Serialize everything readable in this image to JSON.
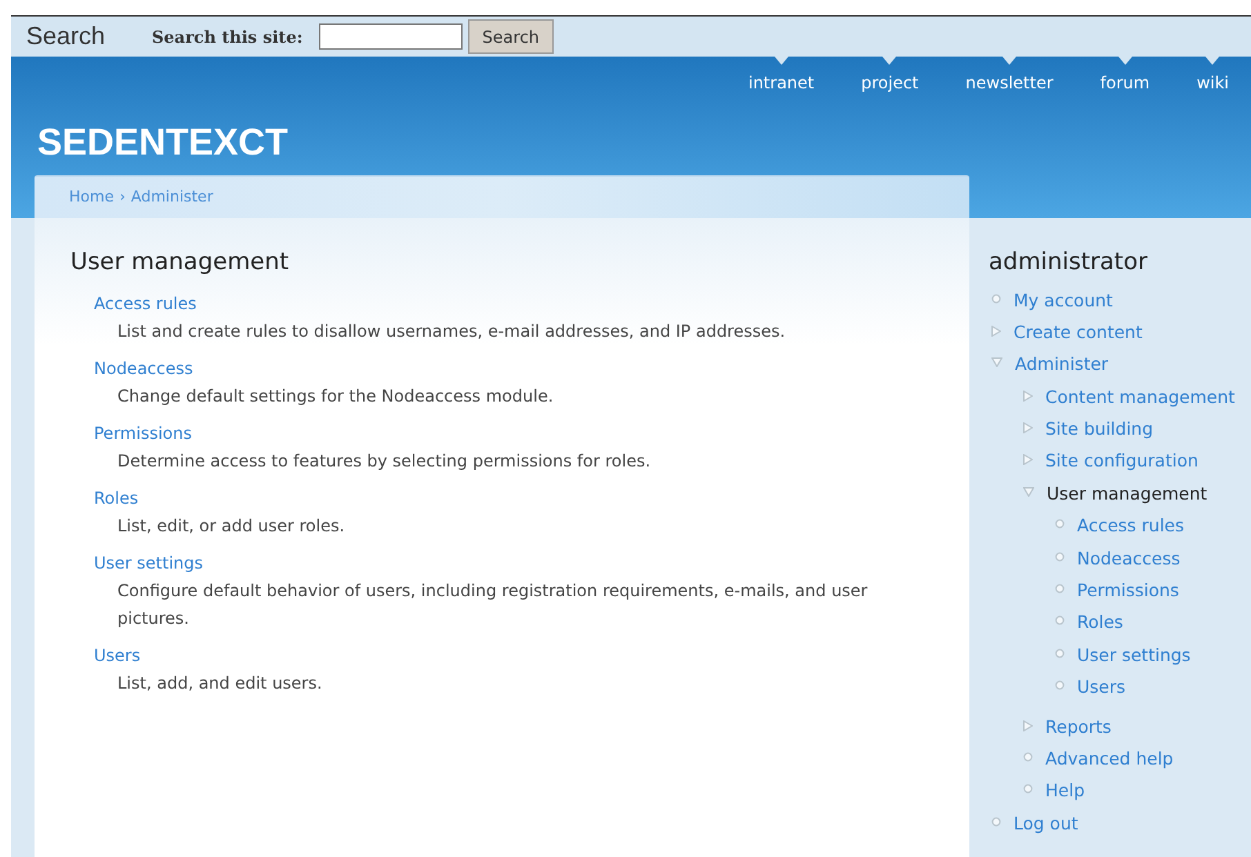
{
  "search_bar": {
    "title": "Search",
    "label": "Search this site:",
    "button": "Search"
  },
  "site_name": "SEDENTEXCT",
  "nav": [
    "intranet",
    "project",
    "newsletter",
    "forum",
    "wiki"
  ],
  "breadcrumb": {
    "items": [
      "Home",
      "Administer"
    ],
    "separator": "›"
  },
  "main": {
    "title": "User management",
    "entries": [
      {
        "link": "Access rules",
        "description": "List and create rules to disallow usernames, e-mail addresses, and IP addresses."
      },
      {
        "link": "Nodeaccess",
        "description": "Change default settings for the Nodeaccess module."
      },
      {
        "link": "Permissions",
        "description": "Determine access to features by selecting permissions for roles."
      },
      {
        "link": "Roles",
        "description": "List, edit, or add user roles."
      },
      {
        "link": "User settings",
        "description": "Configure default behavior of users, including registration requirements, e-mails, and user pictures."
      },
      {
        "link": "Users",
        "description": "List, add, and edit users."
      }
    ]
  },
  "sidebar": {
    "title": "administrator",
    "items": [
      {
        "label": "My account",
        "kind": "leaf",
        "selected": false
      },
      {
        "label": "Create content",
        "kind": "collapsed",
        "selected": false
      },
      {
        "label": "Administer",
        "kind": "expanded",
        "selected": false,
        "children": [
          {
            "label": "Content management",
            "kind": "collapsed",
            "selected": false
          },
          {
            "label": "Site building",
            "kind": "collapsed",
            "selected": false
          },
          {
            "label": "Site configuration",
            "kind": "collapsed",
            "selected": false
          },
          {
            "label": "User management",
            "kind": "expanded",
            "selected": true,
            "children": [
              {
                "label": "Access rules",
                "kind": "leaf",
                "selected": false
              },
              {
                "label": "Nodeaccess",
                "kind": "leaf",
                "selected": false
              },
              {
                "label": "Permissions",
                "kind": "leaf",
                "selected": false
              },
              {
                "label": "Roles",
                "kind": "leaf",
                "selected": false
              },
              {
                "label": "User settings",
                "kind": "leaf",
                "selected": false
              },
              {
                "label": "Users",
                "kind": "leaf",
                "selected": false
              }
            ]
          },
          {
            "label": "Reports",
            "kind": "collapsed",
            "selected": false
          },
          {
            "label": "Advanced help",
            "kind": "leaf",
            "selected": false
          },
          {
            "label": "Help",
            "kind": "leaf",
            "selected": false
          }
        ]
      },
      {
        "label": "Log out",
        "kind": "leaf",
        "selected": false
      }
    ]
  }
}
